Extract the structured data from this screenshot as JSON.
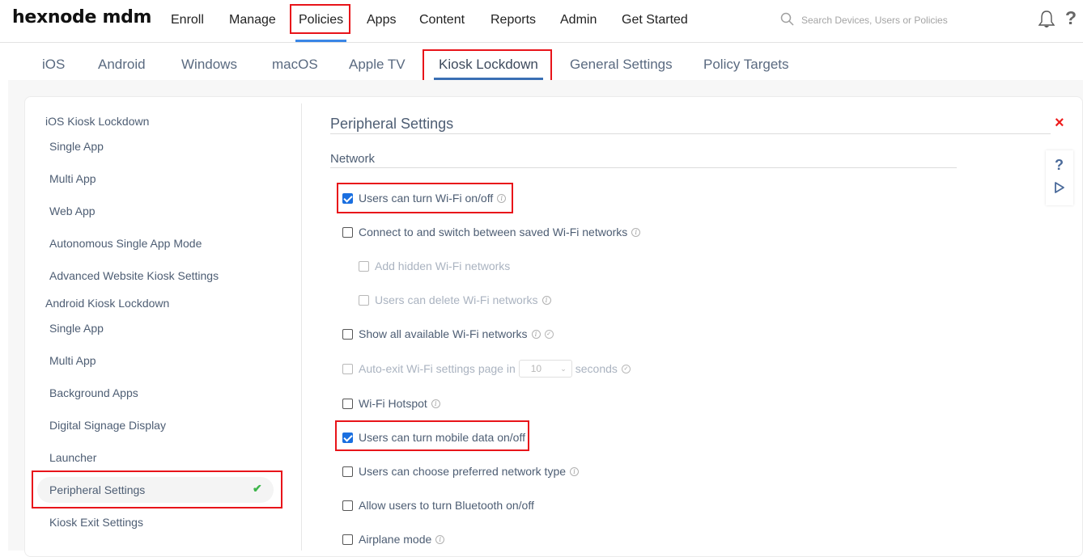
{
  "app": {
    "logo": "hexnode mdm"
  },
  "topnav": {
    "items": [
      "Enroll",
      "Manage",
      "Policies",
      "Apps",
      "Content",
      "Reports",
      "Admin",
      "Get Started"
    ],
    "active": "Policies"
  },
  "search": {
    "placeholder": "Search Devices, Users or Policies"
  },
  "header_icons": {
    "notifications": "bell-icon",
    "help": "?"
  },
  "subtabs": {
    "items": [
      "iOS",
      "Android",
      "Windows",
      "macOS",
      "Apple TV",
      "Kiosk Lockdown",
      "General Settings",
      "Policy Targets"
    ],
    "active": "Kiosk Lockdown"
  },
  "sidebar": {
    "groups": [
      {
        "label": "iOS Kiosk Lockdown",
        "items": [
          "Single App",
          "Multi App",
          "Web App",
          "Autonomous Single App Mode",
          "Advanced Website Kiosk Settings"
        ]
      },
      {
        "label": "Android Kiosk Lockdown",
        "items": [
          "Single App",
          "Multi App",
          "Background Apps",
          "Digital Signage Display",
          "Launcher",
          "Peripheral Settings",
          "Kiosk Exit Settings"
        ]
      }
    ],
    "active_item": "Peripheral Settings",
    "active_status": "configured"
  },
  "main": {
    "title": "Peripheral Settings",
    "close": "×",
    "section": "Network",
    "helper": {
      "help": "?",
      "play": "play-icon"
    },
    "options": [
      {
        "label": "Users can turn Wi-Fi on/off",
        "checked": true,
        "info": true
      },
      {
        "label": "Connect to and switch between saved Wi-Fi networks",
        "checked": false,
        "info": true
      },
      {
        "label": "Add hidden Wi-Fi networks",
        "checked": false,
        "disabled": true
      },
      {
        "label": "Users can delete Wi-Fi networks",
        "checked": false,
        "disabled": true,
        "info": true
      },
      {
        "label": "Show all available Wi-Fi networks",
        "checked": false,
        "info": true,
        "verified": true
      },
      {
        "label": "Auto-exit Wi-Fi settings page in",
        "suffix": "seconds",
        "checked": false,
        "disabled": true,
        "select_value": "10",
        "verified": true
      },
      {
        "label": "Wi-Fi Hotspot",
        "checked": false,
        "info": true
      },
      {
        "label": "Users can turn mobile data on/off",
        "checked": true
      },
      {
        "label": "Users can choose preferred network type",
        "checked": false,
        "info": true
      },
      {
        "label": "Allow users to turn Bluetooth on/off",
        "checked": false
      },
      {
        "label": "Airplane mode",
        "checked": false,
        "info": true
      }
    ]
  },
  "colors": {
    "accent": "#1a6fe0",
    "highlight_box": "#e8141a",
    "text": "#4d5d73",
    "success": "#3db54a",
    "close": "#ee1c1c"
  }
}
